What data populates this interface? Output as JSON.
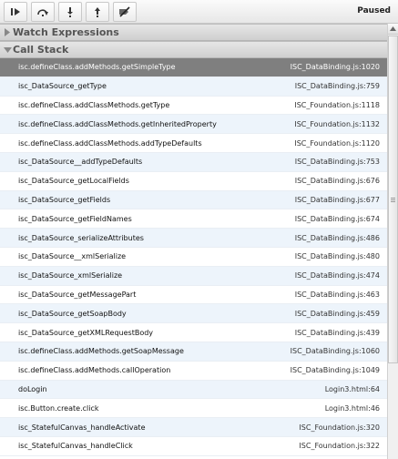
{
  "toolbar": {
    "buttons": [
      {
        "icon": "resume-icon"
      },
      {
        "icon": "step-over-icon"
      },
      {
        "icon": "step-into-icon"
      },
      {
        "icon": "step-out-icon"
      },
      {
        "icon": "disable-breakpoints-icon"
      }
    ],
    "status": "Paused"
  },
  "watch": {
    "title": "Watch Expressions",
    "collapsed": true
  },
  "callstack": {
    "title": "Call Stack",
    "selected_index": 0,
    "frames": [
      {
        "fn": "isc.defineClass.addMethods.getSimpleType",
        "loc": "ISC_DataBinding.js:1020"
      },
      {
        "fn": "isc_DataSource_getType",
        "loc": "ISC_DataBinding.js:759"
      },
      {
        "fn": "isc.defineClass.addClassMethods.getType",
        "loc": "ISC_Foundation.js:1118"
      },
      {
        "fn": "isc.defineClass.addClassMethods.getInheritedProperty",
        "loc": "ISC_Foundation.js:1132"
      },
      {
        "fn": "isc.defineClass.addClassMethods.addTypeDefaults",
        "loc": "ISC_Foundation.js:1120"
      },
      {
        "fn": "isc_DataSource__addTypeDefaults",
        "loc": "ISC_DataBinding.js:753"
      },
      {
        "fn": "isc_DataSource_getLocalFields",
        "loc": "ISC_DataBinding.js:676"
      },
      {
        "fn": "isc_DataSource_getFields",
        "loc": "ISC_DataBinding.js:677"
      },
      {
        "fn": "isc_DataSource_getFieldNames",
        "loc": "ISC_DataBinding.js:674"
      },
      {
        "fn": "isc_DataSource_serializeAttributes",
        "loc": "ISC_DataBinding.js:486"
      },
      {
        "fn": "isc_DataSource__xmlSerialize",
        "loc": "ISC_DataBinding.js:480"
      },
      {
        "fn": "isc_DataSource_xmlSerialize",
        "loc": "ISC_DataBinding.js:474"
      },
      {
        "fn": "isc_DataSource_getMessagePart",
        "loc": "ISC_DataBinding.js:463"
      },
      {
        "fn": "isc_DataSource_getSoapBody",
        "loc": "ISC_DataBinding.js:459"
      },
      {
        "fn": "isc_DataSource_getXMLRequestBody",
        "loc": "ISC_DataBinding.js:439"
      },
      {
        "fn": "isc.defineClass.addMethods.getSoapMessage",
        "loc": "ISC_DataBinding.js:1060"
      },
      {
        "fn": "isc.defineClass.addMethods.callOperation",
        "loc": "ISC_DataBinding.js:1049"
      },
      {
        "fn": "doLogin",
        "loc": "Login3.html:64"
      },
      {
        "fn": "isc.Button.create.click",
        "loc": "Login3.html:46"
      },
      {
        "fn": "isc_StatefulCanvas_handleActivate",
        "loc": "ISC_Foundation.js:320"
      },
      {
        "fn": "isc_StatefulCanvas_handleClick",
        "loc": "ISC_Foundation.js:322"
      }
    ]
  },
  "colors": {
    "selected_row": "#7f7f7f",
    "alt_row": "#edf4fb",
    "header_text": "#555555"
  }
}
